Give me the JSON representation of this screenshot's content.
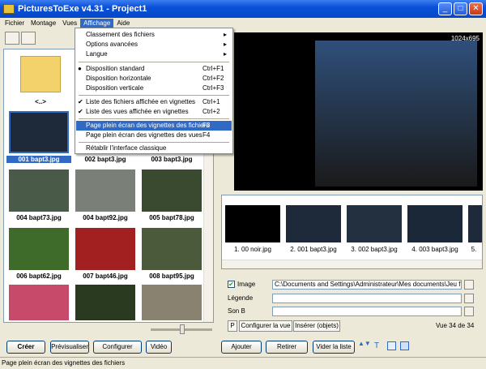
{
  "window": {
    "title": "PicturesToExe v4.31 - Project1"
  },
  "menubar": {
    "items": [
      "Fichier",
      "Montage",
      "Vues",
      "Affichage",
      "Aide"
    ]
  },
  "affichage_menu": {
    "items": [
      {
        "label": "Classement des fichiers",
        "shortcut": "",
        "mark": "",
        "arrow": "▸"
      },
      {
        "label": "Options avancées",
        "shortcut": "",
        "mark": "",
        "arrow": "▸"
      },
      {
        "label": "Langue",
        "shortcut": "",
        "mark": "",
        "arrow": "▸"
      },
      {
        "label": "Disposition standard",
        "shortcut": "Ctrl+F1",
        "mark": "●",
        "arrow": ""
      },
      {
        "label": "Disposition horizontale",
        "shortcut": "Ctrl+F2",
        "mark": "",
        "arrow": ""
      },
      {
        "label": "Disposition verticale",
        "shortcut": "Ctrl+F3",
        "mark": "",
        "arrow": ""
      },
      {
        "label": "Liste des fichiers affichée en vignettes",
        "shortcut": "Ctrl+1",
        "mark": "✔",
        "arrow": ""
      },
      {
        "label": "Liste des vues affichée en vignettes",
        "shortcut": "Ctrl+2",
        "mark": "✔",
        "arrow": ""
      },
      {
        "label": "Page plein écran des vignettes des fichiers",
        "shortcut": "F3",
        "mark": "",
        "arrow": ""
      },
      {
        "label": "Page plein écran des vignettes des vues",
        "shortcut": "F4",
        "mark": "",
        "arrow": ""
      },
      {
        "label": "Rétablir l'interface classique",
        "shortcut": "",
        "mark": "",
        "arrow": ""
      }
    ]
  },
  "file_panel": {
    "folder_label": "<..>",
    "thumbnails": [
      {
        "label": "001 bapt3.jpg"
      },
      {
        "label": "002 bapt3.jpg"
      },
      {
        "label": "003 bapt3.jpg"
      },
      {
        "label": "004 bapt73.jpg"
      },
      {
        "label": "004 bapt92.jpg"
      },
      {
        "label": "005 bapt78.jpg"
      },
      {
        "label": "006 bapt62.jpg"
      },
      {
        "label": "007 bapt46.jpg"
      },
      {
        "label": "008 bapt95.jpg"
      }
    ]
  },
  "preview": {
    "resolution": "1024x695"
  },
  "slides_strip": {
    "items": [
      {
        "label": "1. 00 noir.jpg"
      },
      {
        "label": "2. 001 bapt3.jpg"
      },
      {
        "label": "3. 002 bapt3.jpg"
      },
      {
        "label": "4. 003 bapt3.jpg"
      },
      {
        "label": "5."
      }
    ]
  },
  "properties": {
    "image_label": "Image",
    "image_path": "C:\\Documents and Settings\\Administrateur\\Mes documents\\Jeu fun\\bap",
    "legend_label": "Légende",
    "legend_value": "",
    "sonb_label": "Son B",
    "sonb_value": "",
    "tab_p": "P",
    "tab_configure": "Configurer la vue",
    "tab_insert": "Insérer (objets)",
    "view_counter": "Vue 34 de 34"
  },
  "bottom": {
    "create": "Créer",
    "preview": "Prévisualiser",
    "configure": "Configurer",
    "video": "Vidéo",
    "add": "Ajouter",
    "remove": "Retirer",
    "clear": "Vider la liste"
  },
  "statusbar": {
    "text": "Page plein écran des vignettes des fichiers"
  },
  "colors": {
    "accent": "#316ac5",
    "title": "#0a50d8"
  }
}
